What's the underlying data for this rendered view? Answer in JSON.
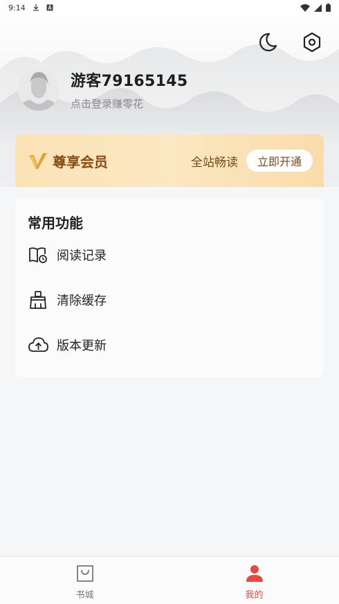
{
  "status_bar": {
    "time": "9:14",
    "icons": [
      "download-icon",
      "a-icon",
      "wifi-icon",
      "signal-icon",
      "battery-icon"
    ]
  },
  "header": {
    "actions": [
      {
        "name": "night-mode",
        "icon": "moon-icon"
      },
      {
        "name": "settings",
        "icon": "hexagon-gear-icon"
      }
    ]
  },
  "profile": {
    "username": "游客79165145",
    "login_hint": "点击登录赚零花"
  },
  "vip": {
    "title": "尊享会员",
    "description": "全站畅读",
    "button_label": "立即开通",
    "colors": {
      "text": "#8a4b12",
      "bg_start": "#fbe3b6",
      "bg_end": "#f9dcaa"
    }
  },
  "functions": {
    "heading": "常用功能",
    "items": [
      {
        "label": "阅读记录",
        "icon": "book-history-icon"
      },
      {
        "label": "清除缓存",
        "icon": "broom-icon"
      },
      {
        "label": "版本更新",
        "icon": "cloud-upload-icon"
      }
    ]
  },
  "bottom_nav": {
    "items": [
      {
        "label": "书城",
        "icon": "shopping-bag-icon",
        "active": false
      },
      {
        "label": "我的",
        "icon": "user-icon",
        "active": true
      }
    ],
    "active_color": "#e8483f"
  }
}
